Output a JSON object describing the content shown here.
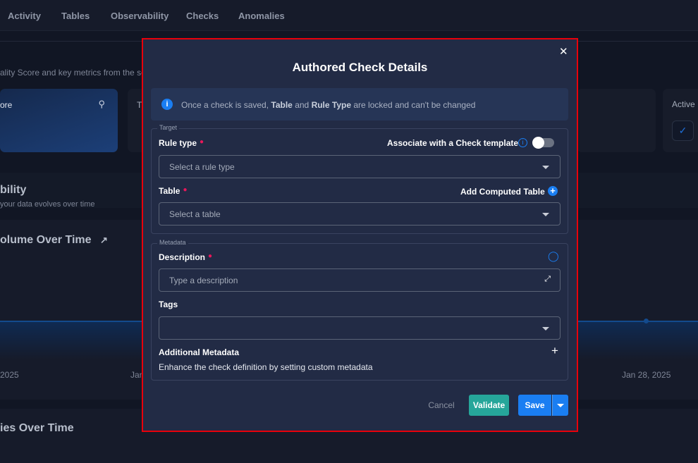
{
  "nav": {
    "items": [
      "Activity",
      "Tables",
      "Observability",
      "Checks",
      "Anomalies"
    ]
  },
  "background": {
    "subtitle": "ality Score and key metrics from the so",
    "card_title": "ore",
    "card2_title": "T",
    "active_card_title": "Active",
    "section_title": "bility",
    "section_desc": "your data evolves over time",
    "chart_title": "olume Over Time",
    "chart_ticks": [
      "2025",
      "Jan",
      "Jan 28, 2025"
    ],
    "panel2_title": "ies Over Time"
  },
  "modal": {
    "title": "Authored Check Details",
    "info": {
      "pre": "Once a check is saved, ",
      "b1": "Table",
      "mid": " and ",
      "b2": "Rule Type",
      "post": " are locked and can't be changed"
    },
    "target": {
      "legend": "Target",
      "rule_type_label": "Rule type",
      "template_label": "Associate with a Check template",
      "template_toggle_on": false,
      "rule_type_placeholder": "Select a rule type",
      "table_label": "Table",
      "add_computed_label": "Add Computed Table",
      "table_placeholder": "Select a table"
    },
    "metadata": {
      "legend": "Metadata",
      "description_label": "Description",
      "description_placeholder": "Type a description",
      "tags_label": "Tags",
      "additional_label": "Additional Metadata",
      "additional_desc": "Enhance the check definition by setting custom metadata"
    },
    "buttons": {
      "cancel": "Cancel",
      "validate": "Validate",
      "save": "Save"
    }
  },
  "colors": {
    "accent": "#1a7ef2",
    "validate": "#26a69a",
    "highlight_border": "#e8000b",
    "required": "#e8185a"
  }
}
